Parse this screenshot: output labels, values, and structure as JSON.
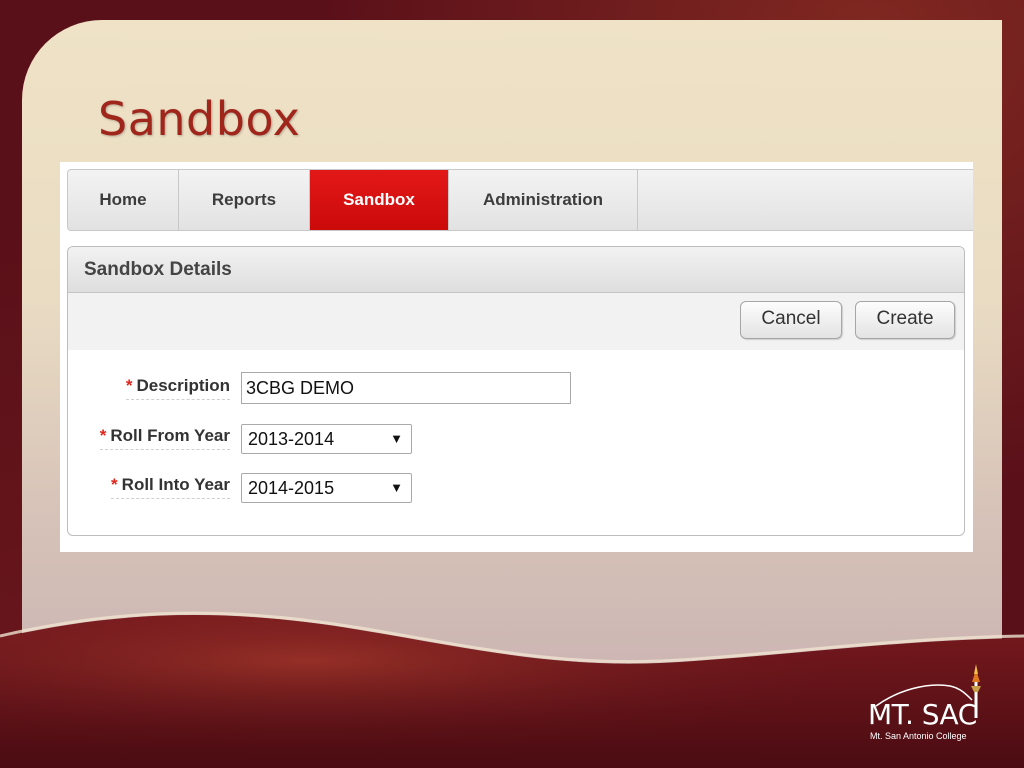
{
  "slide": {
    "title": "Sandbox"
  },
  "nav": {
    "tabs": [
      {
        "label": "Home",
        "active": false
      },
      {
        "label": "Reports",
        "active": false
      },
      {
        "label": "Sandbox",
        "active": true
      },
      {
        "label": "Administration",
        "active": false
      }
    ]
  },
  "details": {
    "title": "Sandbox Details",
    "buttons": {
      "cancel": "Cancel",
      "create": "Create"
    },
    "fields": {
      "description": {
        "required_mark": "*",
        "label": "Description",
        "value": "3CBG DEMO"
      },
      "roll_from_year": {
        "required_mark": "*",
        "label": "Roll From Year",
        "value": "2013-2014",
        "arrow": "▼"
      },
      "roll_into_year": {
        "required_mark": "*",
        "label": "Roll Into Year",
        "value": "2014-2015",
        "arrow": "▼"
      }
    }
  },
  "logo": {
    "name": "MT. SAC",
    "subtitle": "Mt. San Antonio College"
  },
  "colors": {
    "title_red": "#a0261c",
    "active_tab_red": "#d61010",
    "required_star": "#e0251b",
    "slide_border": "#5a1019"
  }
}
